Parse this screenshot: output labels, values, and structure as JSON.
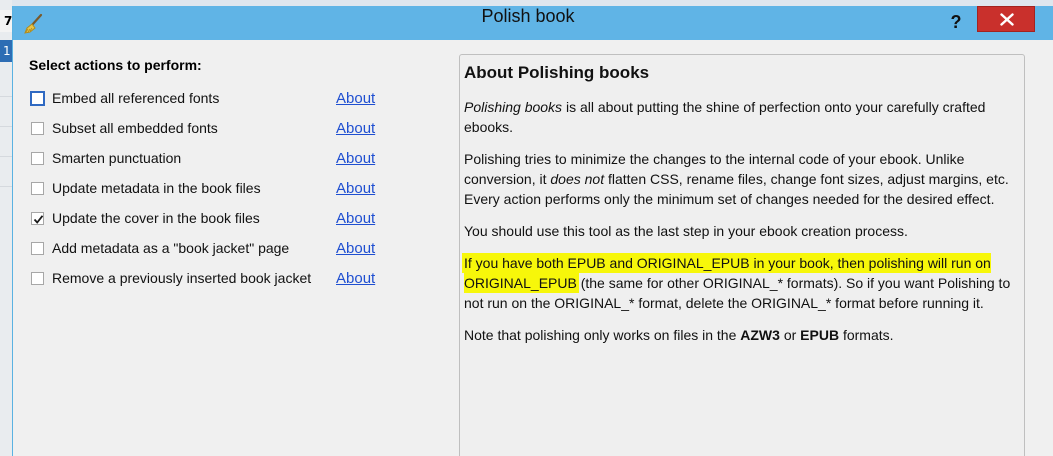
{
  "window": {
    "title": "Polish book",
    "help_label": "?",
    "bg_cell_1": "7",
    "bg_cell_2": "1"
  },
  "left": {
    "heading": "Select actions to perform:",
    "actions": [
      {
        "label": "Embed all referenced fonts",
        "checked": false,
        "about": "About"
      },
      {
        "label": "Subset all embedded fonts",
        "checked": false,
        "about": "About"
      },
      {
        "label": "Smarten punctuation",
        "checked": false,
        "about": "About"
      },
      {
        "label": "Update metadata in the book files",
        "checked": false,
        "about": "About"
      },
      {
        "label": "Update the cover in the book files",
        "checked": true,
        "about": "About"
      },
      {
        "label": "Add metadata as a \"book jacket\" page",
        "checked": false,
        "about": "About"
      },
      {
        "label": "Remove a previously inserted book jacket",
        "checked": false,
        "about": "About"
      }
    ]
  },
  "info": {
    "title": "About Polishing books",
    "p1_em": "Polishing books",
    "p1_rest": " is all about putting the shine of perfection onto your carefully crafted ebooks.",
    "p2_a": "Polishing tries to minimize the changes to the internal code of your ebook. Unlike conversion, it ",
    "p2_em": "does not",
    "p2_b": " flatten CSS, rename files, change font sizes, adjust margins, etc. Every action performs only the minimum set of changes needed for the desired effect.",
    "p3": "You should use this tool as the last step in your ebook creation process.",
    "p4_hl": "If you have both EPUB and ORIGINAL_EPUB in your book, then polishing will run on ORIGINAL_EPUB",
    "p4_rest": " (the same for other ORIGINAL_* formats). So if you want Polishing to not run on the ORIGINAL_* format, delete the ORIGINAL_* format before running it.",
    "p5_a": "Note that polishing only works on files in the ",
    "p5_b1": "AZW3",
    "p5_mid": " or ",
    "p5_b2": "EPUB",
    "p5_end": " formats."
  },
  "colors": {
    "titlebar": "#60b4e6",
    "close": "#c9302c",
    "link": "#1f4fd1",
    "highlight": "#f7f70a"
  }
}
